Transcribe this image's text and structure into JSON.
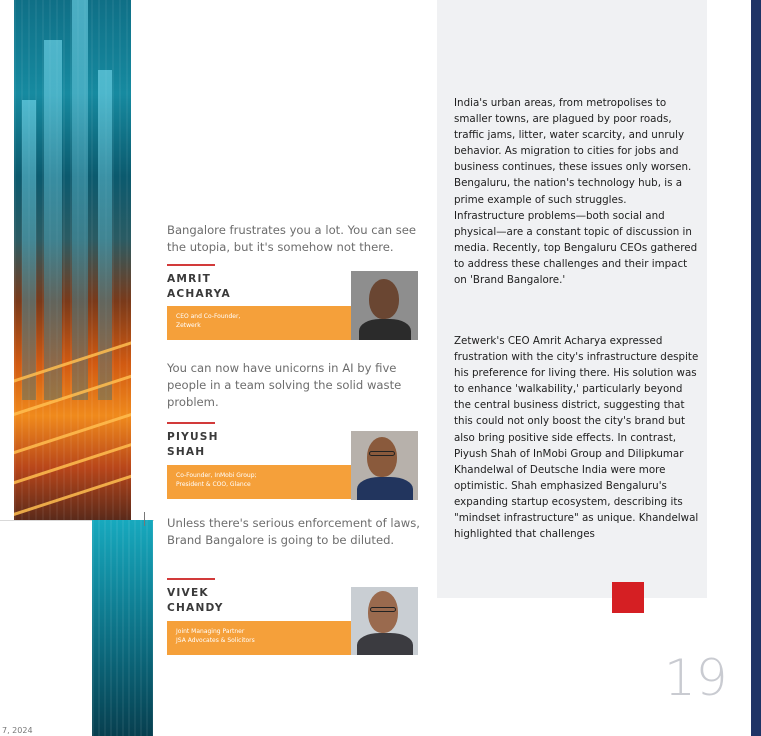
{
  "quotes": [
    {
      "text": "Bangalore frustrates you a lot. You can see the utopia, but it's somehow not there.",
      "name": "AMRIT\nACHARYA",
      "role": "CEO and Co-Founder,\nZetwerk"
    },
    {
      "text": "You can now have unicorns in AI by five people in a team solving the solid waste problem.",
      "name": "PIYUSH\nSHAH",
      "role": "Co-Founder, InMobi Group;\nPresident & COO, Glance"
    },
    {
      "text": "Unless there's serious enforcement of laws, Brand Bangalore is going to be diluted.",
      "name": "VIVEK\nCHANDY",
      "role": "Joint Managing Partner\nJSA Advocates & Solicitors"
    }
  ],
  "article": {
    "paragraph_1": "India's urban areas, from metropolises to smaller towns, are plagued by poor roads, traffic jams, litter, water scarcity, and unruly behavior. As migration to cities for jobs and business continues, these issues only worsen. Bengaluru, the nation's technology hub, is a prime example of such struggles. Infrastructure problems—both social and physical—are a constant topic of discussion in media. Recently, top Bengaluru CEOs gathered to address these challenges and their impact on 'Brand Bangalore.'",
    "paragraph_2": "Zetwerk's CEO Amrit Acharya expressed frustration with the city's infrastructure despite his preference for living there. His solution was to enhance 'walkability,' particularly beyond the central business district, suggesting that this could not only boost the city's brand but also bring positive side effects. In contrast, Piyush Shah of InMobi Group and Dilipkumar Khandelwal of Deutsche India were more optimistic. Shah emphasized Bengaluru's expanding startup ecosystem, describing its \"mindset infrastructure\" as unique. Khandelwal highlighted that challenges"
  },
  "page_number": "19",
  "date_stamp": "7, 2024",
  "colors": {
    "accent_orange": "#f5a03a",
    "accent_red": "#d51f23",
    "rule_red": "#d23a3a",
    "panel_grey": "#f0f1f3",
    "spine_navy": "#1f3466"
  }
}
